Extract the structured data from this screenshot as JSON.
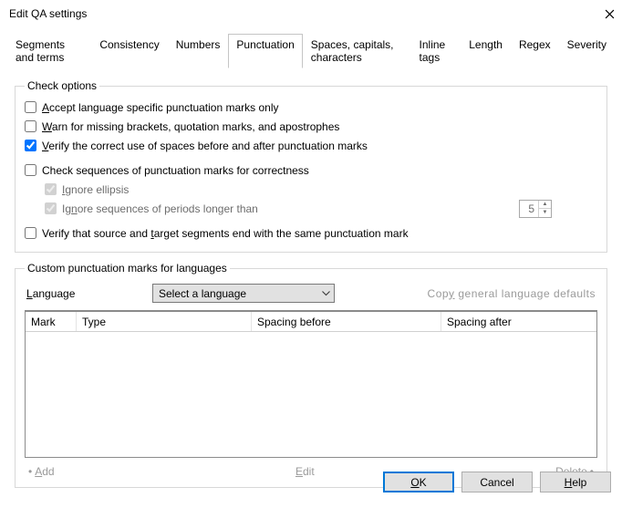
{
  "window": {
    "title": "Edit QA settings"
  },
  "tabs": [
    "Segments and terms",
    "Consistency",
    "Numbers",
    "Punctuation",
    "Spaces, capitals, characters",
    "Inline tags",
    "Length",
    "Regex",
    "Severity"
  ],
  "active_tab_index": 3,
  "check_options": {
    "legend": "Check options",
    "accept": {
      "checked": false,
      "pre": "",
      "u": "A",
      "post": "ccept language specific punctuation marks only"
    },
    "warn": {
      "checked": false,
      "pre": "",
      "u": "W",
      "post": "arn for missing brackets, quotation marks, and apostrophes"
    },
    "verify_spaces": {
      "checked": true,
      "pre": "",
      "u": "V",
      "post": "erify the correct use of spaces before and after punctuation marks"
    },
    "check_seq": {
      "checked": false,
      "label": "Check sequences of punctuation marks for correctness"
    },
    "ignore_ellipsis": {
      "checked": true,
      "pre": "",
      "u": "I",
      "post": "gnore ellipsis"
    },
    "ignore_periods": {
      "checked": true,
      "pre": "Ig",
      "u": "n",
      "post": "ore sequences of periods longer than",
      "value": "5"
    },
    "verify_end": {
      "checked": false,
      "pre": "Verify that source and ",
      "u": "t",
      "post": "arget segments end with the same punctuation mark"
    }
  },
  "custom": {
    "legend": "Custom punctuation marks for languages",
    "language_label_pre": "",
    "language_label_u": "L",
    "language_label_post": "anguage",
    "select_placeholder": "Select a language",
    "copy_defaults_pre": "Cop",
    "copy_defaults_u": "y",
    "copy_defaults_post": " general language defaults",
    "columns": {
      "mark": "Mark",
      "type": "Type",
      "before": "Spacing before",
      "after": "Spacing after"
    },
    "actions": {
      "add_u": "A",
      "add_post": "dd",
      "edit_pre": "",
      "edit_u": "E",
      "edit_post": "dit",
      "delete_pre": "",
      "delete_u": "D",
      "delete_post": "elete"
    }
  },
  "footer": {
    "ok_u": "O",
    "ok_post": "K",
    "cancel": "Cancel",
    "help_u": "H",
    "help_post": "elp"
  }
}
